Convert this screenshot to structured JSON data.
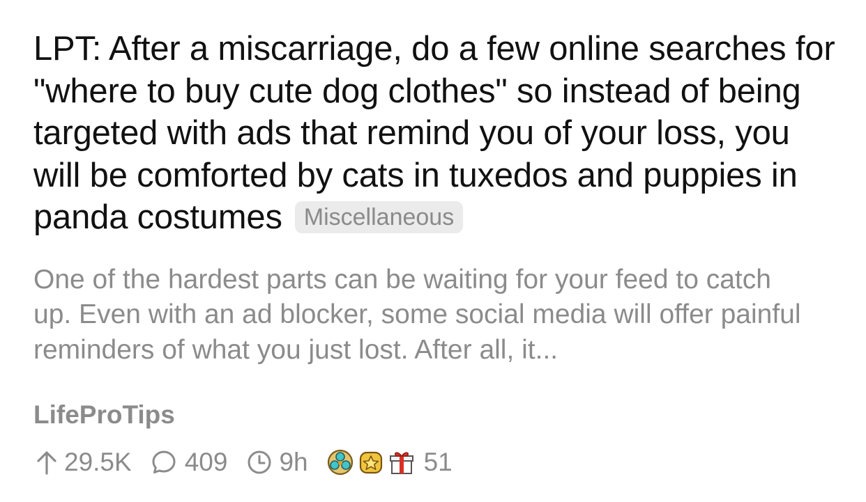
{
  "post": {
    "title": "LPT: After a miscarriage, do a few online searches for \"where to buy cute dog clothes\" so instead of being targeted with ads that remind you of your loss, you will be comforted by cats in tuxedos and puppies in panda costumes",
    "flair": "Miscellaneous",
    "preview": "One of the hardest parts can be waiting for your feed to catch up. Even with an ad blocker, some social media will offer painful reminders of what you just lost. After all, it...",
    "subreddit": "LifeProTips"
  },
  "stats": {
    "upvotes": "29.5K",
    "comments": "409",
    "age": "9h",
    "awards_count": "51"
  },
  "icons": {
    "upvote": "arrow-up-icon",
    "comment": "comment-bubble-icon",
    "time": "clock-icon",
    "awards": [
      "gem-award-icon",
      "star-medal-award-icon",
      "gift-award-icon"
    ]
  },
  "colors": {
    "title": "#111111",
    "muted": "#8b8b8b",
    "flair_bg": "#ebebeb"
  }
}
